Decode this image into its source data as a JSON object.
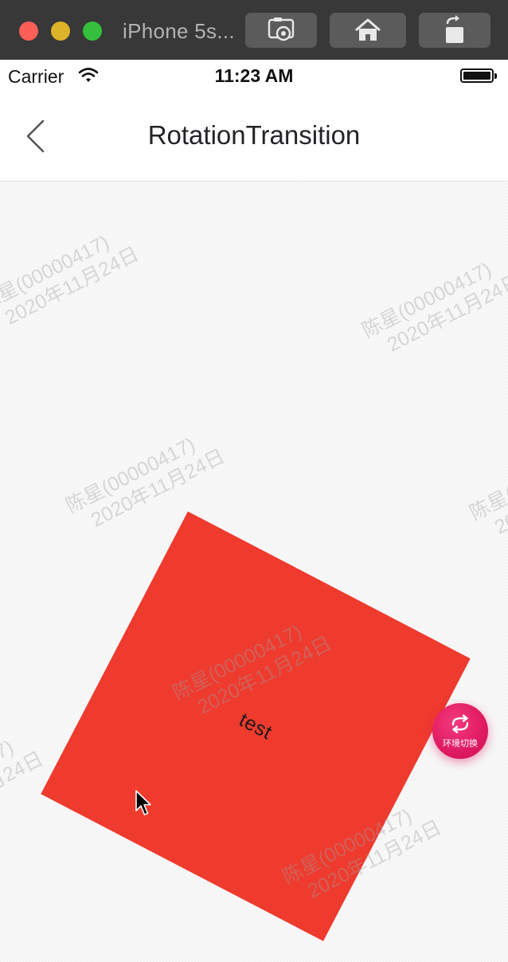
{
  "simulator": {
    "title": "iPhone 5s...",
    "buttons": {
      "screenshot": "screenshot-icon",
      "home": "home-icon",
      "rotate": "rotate-icon"
    }
  },
  "status_bar": {
    "carrier": "Carrier",
    "time": "11:23 AM"
  },
  "nav": {
    "back_icon": "chevron-left-icon",
    "title": "RotationTransition"
  },
  "content": {
    "box_label": "test",
    "box_color": "#ef3a2e",
    "rotation_deg": 27.5
  },
  "watermark": {
    "line1": "陈星(00000417)",
    "line2": "2020年11月24日"
  },
  "fab": {
    "label": "环境切换",
    "icon": "refresh-cycle-icon",
    "color": "#e01a5f"
  }
}
